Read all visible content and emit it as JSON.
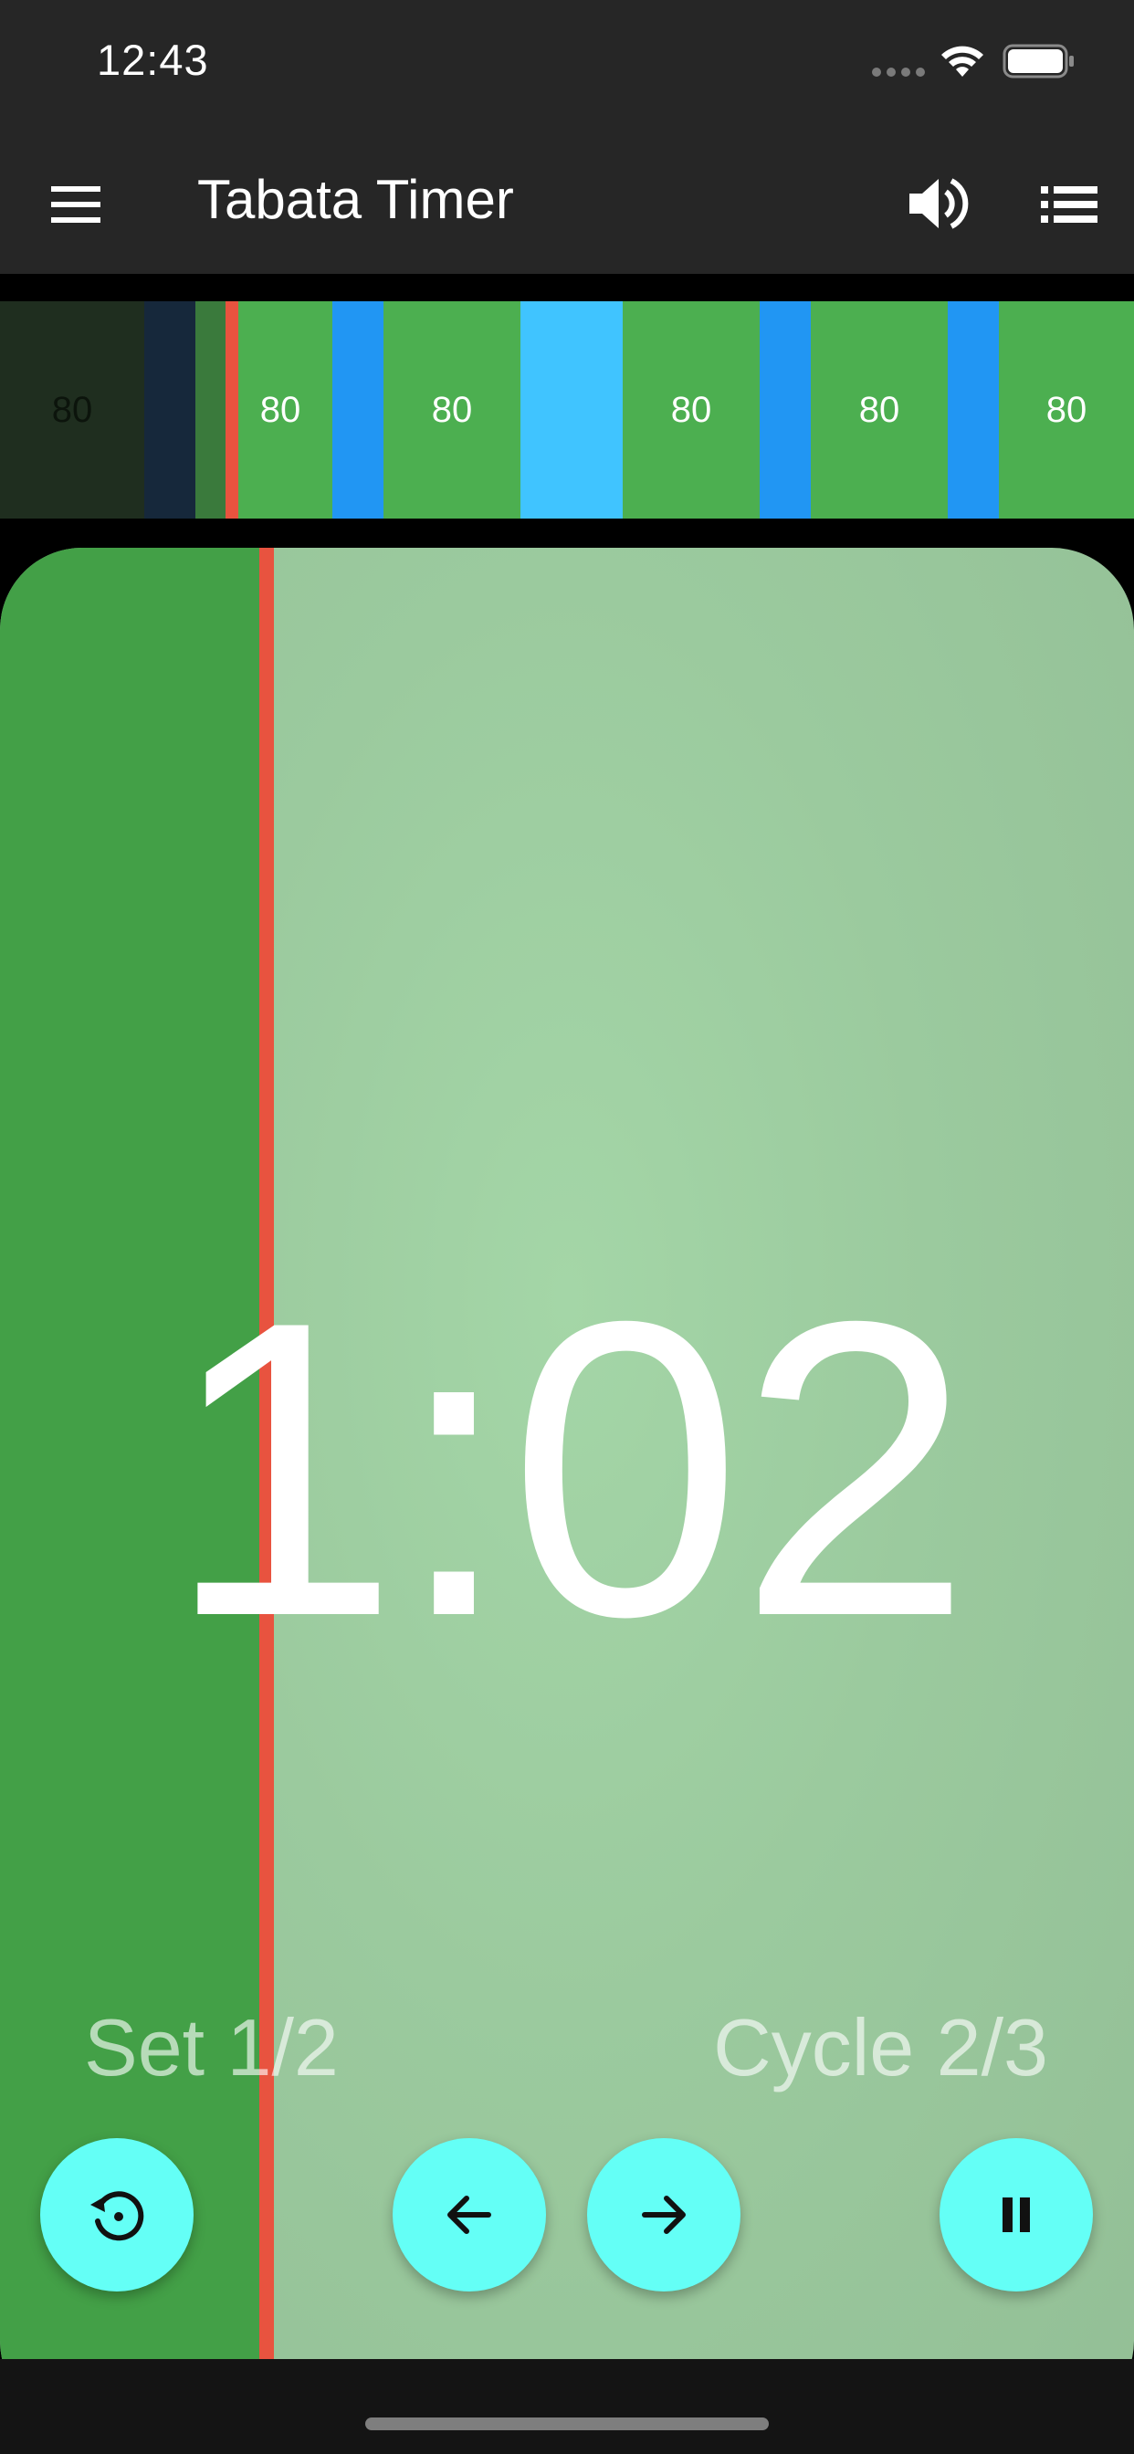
{
  "status_bar": {
    "time": "12:43"
  },
  "app_bar": {
    "title": "Tabata Timer",
    "icons": [
      "menu-icon",
      "volume-icon",
      "list-icon"
    ]
  },
  "timeline": {
    "segments": [
      {
        "label": "80",
        "color": "#1f2e1f"
      },
      {
        "label": "",
        "color": "#16283b"
      },
      {
        "label": "",
        "color": "#3a7a3c"
      },
      {
        "label": "80",
        "color": "#4caf50"
      },
      {
        "label": "",
        "color": "#2196f3"
      },
      {
        "label": "80",
        "color": "#4caf50"
      },
      {
        "label": "",
        "color": "#40c4ff"
      },
      {
        "label": "80",
        "color": "#4caf50"
      },
      {
        "label": "",
        "color": "#2196f3"
      },
      {
        "label": "80",
        "color": "#4caf50"
      },
      {
        "label": "",
        "color": "#2196f3"
      },
      {
        "label": "80",
        "color": "#4caf50"
      }
    ],
    "marker_color": "#e8533f"
  },
  "card": {
    "timer": "1:02",
    "set_label": "Set 1/2",
    "cycle_label": "Cycle 2/3",
    "progress_color": "#43a047",
    "background_color": "#9bca9e"
  },
  "controls": {
    "accent_color": "#64fff6",
    "buttons": [
      "reset-icon",
      "arrow-left-icon",
      "arrow-right-icon",
      "pause-icon"
    ]
  }
}
